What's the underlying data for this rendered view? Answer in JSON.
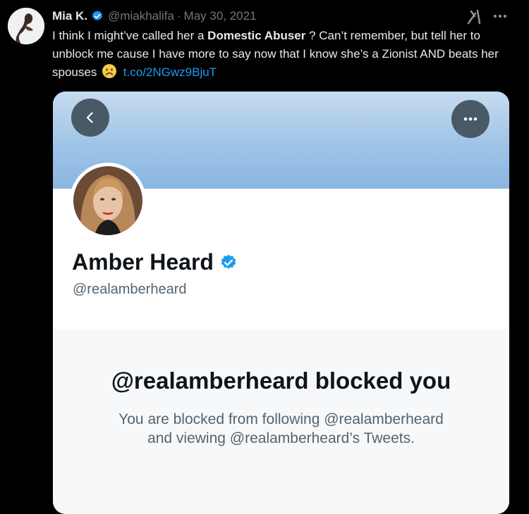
{
  "tweet": {
    "author_name": "Mia K.",
    "author_handle": "@miakhalifa",
    "separator": "·",
    "date": "May 30, 2021",
    "text_part1": "I think I might’ve called her a ",
    "text_bold": "Domestic Abuser",
    "text_part2": " ? Can’t remember, but tell her to unblock me cause I have more to say now that I know she’s a Zionist AND beats her spouses",
    "link": "t.co/2NGwz9BjuT",
    "emoji": "frowning-face"
  },
  "card": {
    "profile_name": "Amber Heard",
    "profile_handle": "@realamberheard",
    "blocked_title": "@realamberheard blocked you",
    "blocked_description_line1": "You are blocked from following @realamberheard",
    "blocked_description_line2": "and viewing @realamberheard’s Tweets."
  },
  "colors": {
    "background": "#000000",
    "link": "#1d9bf0",
    "verified": "#1d9bf0",
    "banner": "#9fc4e7"
  }
}
